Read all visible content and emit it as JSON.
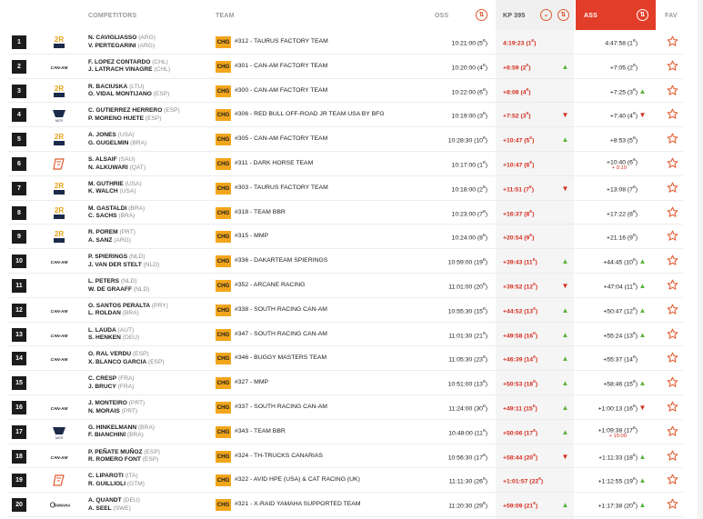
{
  "header": {
    "competitors": "COMPETITORS",
    "team": "TEAM",
    "oss": "OSS",
    "kp": "KP 395",
    "ass": "ASS",
    "fav": "FAV"
  },
  "colors": {
    "accent": "#e23d28",
    "category_badge": "#f2a61c",
    "up": "#5ab03a",
    "down": "#d42b1e"
  },
  "rows": [
    {
      "pos": "1",
      "logo": "taurus",
      "d1": "N. CAVIGLIASSO",
      "c1": "(ARG)",
      "d2": "V. PERTEGARINI",
      "c2": "(ARG)",
      "cat": "CHG",
      "team": "#312 - TAURUS FACTORY TEAM",
      "oss": "10:21:00",
      "oss_rank": "5",
      "kp": "4:19:23",
      "kp_rank": "1",
      "kp_trend": "",
      "ass": "4:47:58",
      "ass_rank": "1",
      "ass_trend": "",
      "penalty": ""
    },
    {
      "pos": "2",
      "logo": "can-am",
      "d1": "F. LOPEZ CONTARDO",
      "c1": "(CHL)",
      "d2": "J. LATRACH VINAGRE",
      "c2": "(CHL)",
      "cat": "CHG",
      "team": "#301 - CAN-AM FACTORY TEAM",
      "oss": "10:20:00",
      "oss_rank": "4",
      "kp": "+6:59",
      "kp_rank": "2",
      "kp_trend": "up",
      "ass": "+7:05",
      "ass_rank": "2",
      "ass_trend": "",
      "penalty": ""
    },
    {
      "pos": "3",
      "logo": "taurus",
      "d1": "R. BACIUSKA",
      "c1": "(LTU)",
      "d2": "O. VIDAL MONTIJANO",
      "c2": "(ESP)",
      "cat": "CHG",
      "team": "#300 - CAN-AM FACTORY TEAM",
      "oss": "10:22:00",
      "oss_rank": "6",
      "kp": "+8:08",
      "kp_rank": "4",
      "kp_trend": "",
      "ass": "+7:25",
      "ass_rank": "3",
      "ass_trend": "up",
      "penalty": ""
    },
    {
      "pos": "4",
      "logo": "mcr",
      "d1": "C. GUTIERREZ HERRERO",
      "c1": "(ESP)",
      "d2": "P. MORENO HUETE",
      "c2": "(ESP)",
      "cat": "CHG",
      "team": "#306 - RED BULL OFF-ROAD JR TEAM USA BY BFG",
      "oss": "10:19:00",
      "oss_rank": "3",
      "kp": "+7:52",
      "kp_rank": "3",
      "kp_trend": "down",
      "ass": "+7:40",
      "ass_rank": "4",
      "ass_trend": "down",
      "penalty": ""
    },
    {
      "pos": "5",
      "logo": "taurus",
      "d1": "A. JONES",
      "c1": "(USA)",
      "d2": "G. GUGELMIN",
      "c2": "(BRA)",
      "cat": "CHG",
      "team": "#305 - CAN-AM FACTORY TEAM",
      "oss": "10:28:30",
      "oss_rank": "10",
      "kp": "+10:47",
      "kp_rank": "5",
      "kp_trend": "up",
      "ass": "+8:53",
      "ass_rank": "5",
      "ass_trend": "",
      "penalty": ""
    },
    {
      "pos": "6",
      "logo": "g",
      "d1": "S. ALSAIF",
      "c1": "(SAU)",
      "d2": "N. ALKUWARI",
      "c2": "(QAT)",
      "cat": "CHG",
      "team": "#311 - DARK HORSE TEAM",
      "oss": "10:17:00",
      "oss_rank": "1",
      "kp": "+10:47",
      "kp_rank": "6",
      "kp_trend": "",
      "ass": "+10:40",
      "ass_rank": "6",
      "ass_trend": "",
      "penalty": "+ 0:10"
    },
    {
      "pos": "7",
      "logo": "taurus",
      "d1": "M. GUTHRIE",
      "c1": "(USA)",
      "d2": "K. WALCH",
      "c2": "(USA)",
      "cat": "CHG",
      "team": "#303 - TAURUS FACTORY TEAM",
      "oss": "10:18:00",
      "oss_rank": "2",
      "kp": "+11:51",
      "kp_rank": "7",
      "kp_trend": "down",
      "ass": "+13:08",
      "ass_rank": "7",
      "ass_trend": "",
      "penalty": ""
    },
    {
      "pos": "8",
      "logo": "taurus",
      "d1": "M. GASTALDI",
      "c1": "(BRA)",
      "d2": "C. SACHS",
      "c2": "(BRA)",
      "cat": "CHG",
      "team": "#318 - TEAM BBR",
      "oss": "10:23:00",
      "oss_rank": "7",
      "kp": "+16:37",
      "kp_rank": "8",
      "kp_trend": "",
      "ass": "+17:22",
      "ass_rank": "8",
      "ass_trend": "",
      "penalty": ""
    },
    {
      "pos": "9",
      "logo": "taurus",
      "d1": "R. POREM",
      "c1": "(PRT)",
      "d2": "A. SANZ",
      "c2": "(ARG)",
      "cat": "CHG",
      "team": "#315 - MMP",
      "oss": "10:24:00",
      "oss_rank": "8",
      "kp": "+20:54",
      "kp_rank": "9",
      "kp_trend": "",
      "ass": "+21:16",
      "ass_rank": "9",
      "ass_trend": "",
      "penalty": ""
    },
    {
      "pos": "10",
      "logo": "can-am",
      "d1": "P. SPIERINGS",
      "c1": "(NLD)",
      "d2": "J. VAN DER STELT",
      "c2": "(NLD)",
      "cat": "CHG",
      "team": "#336 - DAKARTEAM SPIERINGS",
      "oss": "10:59:00",
      "oss_rank": "19",
      "kp": "+39:43",
      "kp_rank": "11",
      "kp_trend": "up",
      "ass": "+44:45",
      "ass_rank": "10",
      "ass_trend": "up",
      "penalty": ""
    },
    {
      "pos": "11",
      "logo": "",
      "d1": "L. PETERS",
      "c1": "(NLD)",
      "d2": "W. DE GRAAFF",
      "c2": "(NLD)",
      "cat": "CHG",
      "team": "#352 - ARCANE RACING",
      "oss": "11:01:00",
      "oss_rank": "20",
      "kp": "+39:52",
      "kp_rank": "12",
      "kp_trend": "down",
      "ass": "+47:04",
      "ass_rank": "11",
      "ass_trend": "up",
      "penalty": ""
    },
    {
      "pos": "12",
      "logo": "can-am",
      "d1": "O. SANTOS PERALTA",
      "c1": "(PRY)",
      "d2": "L. ROLDAN",
      "c2": "(BRA)",
      "cat": "CHG",
      "team": "#338 - SOUTH RACING CAN-AM",
      "oss": "10:55:30",
      "oss_rank": "15",
      "kp": "+44:52",
      "kp_rank": "13",
      "kp_trend": "up",
      "ass": "+50:47",
      "ass_rank": "12",
      "ass_trend": "up",
      "penalty": ""
    },
    {
      "pos": "13",
      "logo": "can-am",
      "d1": "L. LAUDA",
      "c1": "(AUT)",
      "d2": "S. HENKEN",
      "c2": "(DEU)",
      "cat": "CHG",
      "team": "#347 - SOUTH RACING CAN-AM",
      "oss": "11:01:30",
      "oss_rank": "21",
      "kp": "+49:58",
      "kp_rank": "16",
      "kp_trend": "up",
      "ass": "+55:24",
      "ass_rank": "13",
      "ass_trend": "up",
      "penalty": ""
    },
    {
      "pos": "14",
      "logo": "can-am",
      "d1": "O. RAL VERDU",
      "c1": "(ESP)",
      "d2": "X. BLANCO GARCIA",
      "c2": "(ESP)",
      "cat": "CHG",
      "team": "#346 - BUGGY MASTERS TEAM",
      "oss": "11:05:30",
      "oss_rank": "23",
      "kp": "+46:39",
      "kp_rank": "14",
      "kp_trend": "up",
      "ass": "+55:37",
      "ass_rank": "14",
      "ass_trend": "",
      "penalty": ""
    },
    {
      "pos": "15",
      "logo": "",
      "d1": "C. CRESP",
      "c1": "(FRA)",
      "d2": "J. BRUCY",
      "c2": "(FRA)",
      "cat": "CHG",
      "team": "#327 - MMP",
      "oss": "10:51:00",
      "oss_rank": "13",
      "kp": "+50:53",
      "kp_rank": "18",
      "kp_trend": "up",
      "ass": "+58:46",
      "ass_rank": "15",
      "ass_trend": "up",
      "penalty": ""
    },
    {
      "pos": "16",
      "logo": "can-am",
      "d1": "J. MONTEIRO",
      "c1": "(PRT)",
      "d2": "N. MORAIS",
      "c2": "(PRT)",
      "cat": "CHG",
      "team": "#337 - SOUTH RACING CAN-AM",
      "oss": "11:24:00",
      "oss_rank": "30",
      "kp": "+49:11",
      "kp_rank": "15",
      "kp_trend": "up",
      "ass": "+1:00:13",
      "ass_rank": "16",
      "ass_trend": "down",
      "penalty": ""
    },
    {
      "pos": "17",
      "logo": "mcr",
      "d1": "G. HINKELMANN",
      "c1": "(BRA)",
      "d2": "F. BIANCHINI",
      "c2": "(BRA)",
      "cat": "CHG",
      "team": "#343 - TEAM BBR",
      "oss": "10:48:00",
      "oss_rank": "11",
      "kp": "+50:06",
      "kp_rank": "17",
      "kp_trend": "up",
      "ass": "+1:09:38",
      "ass_rank": "17",
      "ass_trend": "",
      "penalty": "+ 15:00"
    },
    {
      "pos": "18",
      "logo": "can-am",
      "d1": "P. PEÑATE MUÑOZ",
      "c1": "(ESP)",
      "d2": "R. ROMERO FONT",
      "c2": "(ESP)",
      "cat": "CHG",
      "team": "#324 - TH-TRUCKS CANARIAS",
      "oss": "10:56:30",
      "oss_rank": "17",
      "kp": "+58:44",
      "kp_rank": "20",
      "kp_trend": "down",
      "ass": "+1:11:33",
      "ass_rank": "18",
      "ass_trend": "up",
      "penalty": ""
    },
    {
      "pos": "19",
      "logo": "g",
      "d1": "C. LIPAROTI",
      "c1": "(ITA)",
      "d2": "R. GUILLIOLI",
      "c2": "(GTM)",
      "cat": "CHG",
      "team": "#322 - AVID HPE (USA) & CAT RACING (UK)",
      "oss": "11:11:30",
      "oss_rank": "26",
      "kp": "+1:01:57",
      "kp_rank": "22",
      "kp_trend": "",
      "ass": "+1:12:55",
      "ass_rank": "19",
      "ass_trend": "up",
      "penalty": ""
    },
    {
      "pos": "20",
      "logo": "yamaha",
      "d1": "A. QUANDT",
      "c1": "(DEU)",
      "d2": "A. SEEL",
      "c2": "(SWE)",
      "cat": "CHG",
      "team": "#321 - X-RAID YAMAHA SUPPORTED TEAM",
      "oss": "11:20:30",
      "oss_rank": "29",
      "kp": "+59:09",
      "kp_rank": "21",
      "kp_trend": "up",
      "ass": "+1:17:38",
      "ass_rank": "20",
      "ass_trend": "up",
      "penalty": ""
    }
  ]
}
